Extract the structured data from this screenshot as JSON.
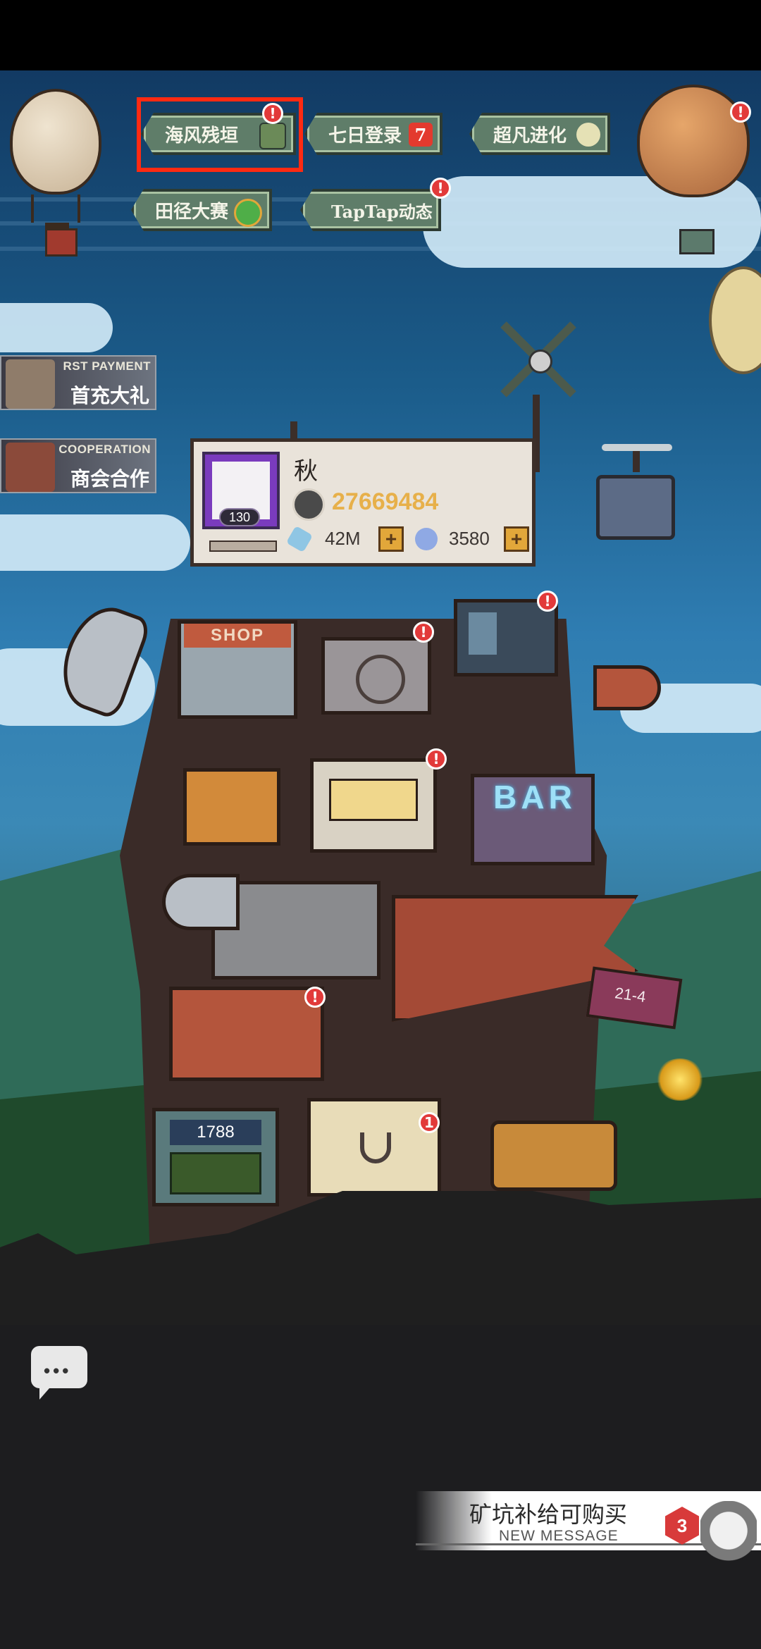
{
  "events_row1": [
    {
      "label": "海风残垣",
      "alert": "!"
    },
    {
      "label": "七日登录",
      "alert": ""
    },
    {
      "label": "超凡进化",
      "alert": ""
    }
  ],
  "events_row2": [
    {
      "label": "田径大赛",
      "alert": ""
    },
    {
      "label": "TapTap动态",
      "alert": "!"
    }
  ],
  "right_balloon_alert": "!",
  "promos": [
    {
      "sub": "RST PAYMENT",
      "main": "首充大礼"
    },
    {
      "sub": "COOPERATION",
      "main": "商会合作"
    }
  ],
  "profile": {
    "name": "秋",
    "level": "130",
    "power": "27669484",
    "resource_a": "42M",
    "resource_b": "3580",
    "add_symbol": "+"
  },
  "tower": {
    "shop_sign": "SHOP",
    "bar_sign": "BAR",
    "stage_flag": "21-4",
    "counter": "1788",
    "alert": "!",
    "crane_badge": "1"
  },
  "chat_icon": "chat-bubble-icon",
  "message": {
    "title": "矿坑补给可购买",
    "subtitle": "NEW MESSAGE",
    "count": "3"
  },
  "colors": {
    "highlight": "#ff2a12",
    "alert": "#e23a3a",
    "power_text": "#e7b04a",
    "banner": "#5f7d69"
  }
}
